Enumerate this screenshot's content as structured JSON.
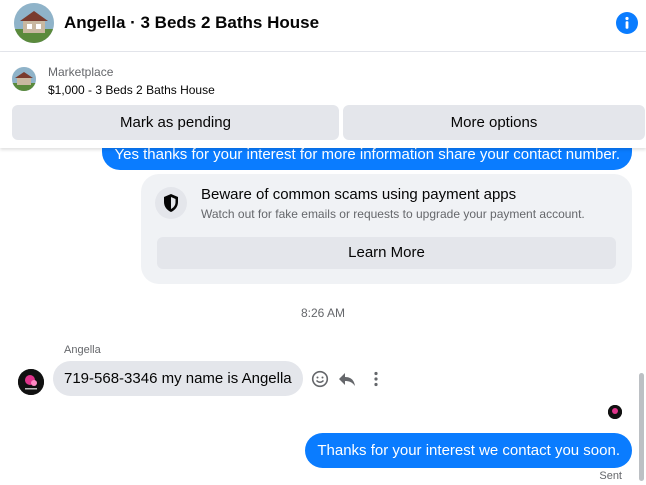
{
  "header": {
    "title": "Angella · 3 Beds 2 Baths House",
    "avatar_icon": "house-photo-icon",
    "info_icon": "info-icon"
  },
  "listing": {
    "source": "Marketplace",
    "price_title": "$1,000 - 3 Beds 2 Baths House",
    "mark_pending_label": "Mark as pending",
    "more_options_label": "More options"
  },
  "thread": {
    "outgoing_top": "Yes thanks for your interest for more information share your contact number.",
    "scam_notice": {
      "title": "Beware of common scams using payment apps",
      "description": "Watch out for fake emails or requests to upgrade your payment account.",
      "learn_more_label": "Learn More"
    },
    "timestamp": "8:26 AM",
    "sender_name": "Angella",
    "incoming_message": "719-568-3346 my name is Angella",
    "outgoing_bottom": "Thanks for your interest we contact you soon.",
    "status": "Sent"
  },
  "colors": {
    "accent": "#0a7cff",
    "bubble_grey": "#e4e6eb",
    "notice_bg": "#f0f2f5",
    "secondary_text": "#65676b"
  }
}
